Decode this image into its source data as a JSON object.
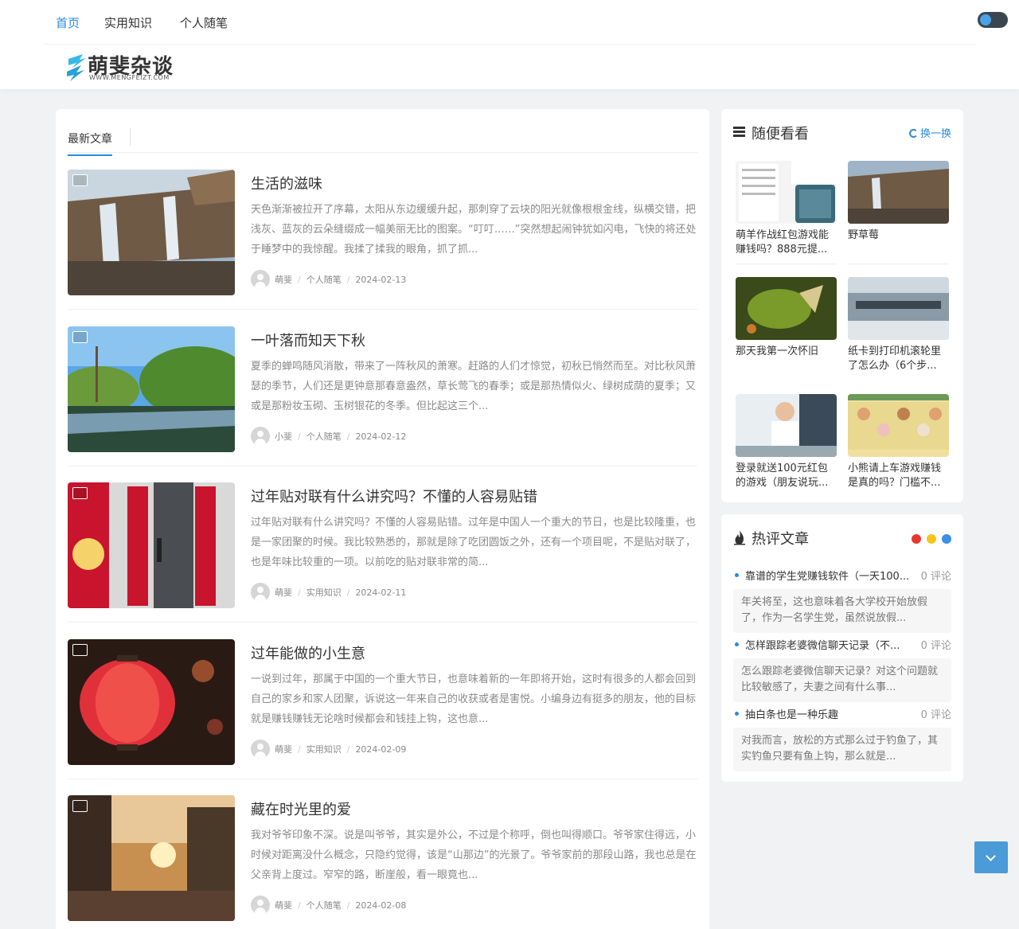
{
  "nav": {
    "items": [
      "首页",
      "实用知识",
      "个人随笔"
    ],
    "active_index": 0
  },
  "logo": {
    "title": "萌斐杂谈",
    "subtitle": "WWW.MENGFEIZT.COM"
  },
  "main": {
    "tab": "最新文章",
    "posts": [
      {
        "title": "生活的滋味",
        "excerpt": "天色渐渐被拉开了序幕，太阳从东边缓缓升起，那刺穿了云块的阳光就像根根金线，纵横交错，把浅灰、蓝灰的云朵缝缀成一幅美丽无比的图案。“叮叮……”突然想起闹钟犹如闪电，飞快的将还处于睡梦中的我惊醒。我揉了揉我的眼角，抓了抓...",
        "author": "萌斐",
        "category": "个人随笔",
        "date": "2024-02-13"
      },
      {
        "title": "一叶落而知天下秋",
        "excerpt": "夏季的蝉鸣随风消散，带来了一阵秋风的萧寒。赶路的人们才惊觉，初秋已悄然而至。对比秋风萧瑟的季节，人们还是更钟意那春意盎然，草长莺飞的春季；或是那热情似火、绿树成荫的夏季；又或是那粉妆玉砌、玉树银花的冬季。但比起这三个...",
        "author": "小斐",
        "category": "个人随笔",
        "date": "2024-02-12"
      },
      {
        "title": "过年贴对联有什么讲究吗？不懂的人容易贴错",
        "excerpt": "过年贴对联有什么讲究吗？不懂的人容易贴错。过年是中国人一个重大的节日，也是比较隆重，也是一家团聚的时候。我比较熟悉的，那就是除了吃团圆饭之外，还有一个项目呢，不是贴对联了，也是年味比较重的一项。以前吃的贴对联非常的简...",
        "author": "萌斐",
        "category": "实用知识",
        "date": "2024-02-11"
      },
      {
        "title": "过年能做的小生意",
        "excerpt": "一说到过年，那属于中国的一个重大节日，也意味着新的一年即将开始，这时有很多的人都会回到自己的家乡和家人团聚，诉说这一年来自己的收获或者是害悦。小编身边有挺多的朋友，他的目标就是赚钱赚钱无论啥时候都会和钱挂上钩，这也意...",
        "author": "萌斐",
        "category": "实用知识",
        "date": "2024-02-09"
      },
      {
        "title": "藏在时光里的爱",
        "excerpt": "我对爷爷印象不深。说是叫爷爷，其实是外公，不过是个称呼，倒也叫得顺口。爷爷家住得远，小时候对距离没什么概念，只隐约觉得，该是“山那边”的光景了。爷爷家前的那段山路，我也总是在父亲背上度过。窄窄的路，断崖般，看一眼竟也...",
        "author": "萌斐",
        "category": "个人随笔",
        "date": "2024-02-08"
      }
    ]
  },
  "random_widget": {
    "title": "随便看看",
    "refresh_label": "换一换",
    "items": [
      {
        "title": "萌羊作战红包游戏能赚钱吗？888元提..."
      },
      {
        "title": "野草莓"
      },
      {
        "title": "那天我第一次怀旧"
      },
      {
        "title": "纸卡到打印机滚轮里了怎么办（6个步..."
      },
      {
        "title": "登录就送100元红包的游戏（朋友说玩..."
      },
      {
        "title": "小熊请上车游戏赚钱是真的吗？门槛不..."
      }
    ]
  },
  "hot_widget": {
    "title": "热评文章",
    "dot_colors": [
      "#e8382e",
      "#f5c518",
      "#3a8ee6"
    ],
    "items": [
      {
        "title": "靠谱的学生党赚钱软件（一天100...",
        "comments": "0 评论",
        "summary": "年关将至，这也意味着各大学校开始放假了，作为一名学生党，虽然说放假..."
      },
      {
        "title": "怎样跟踪老婆微信聊天记录（不...",
        "comments": "0 评论",
        "summary": "怎么跟踪老婆微信聊天记录？对这个问题就比较敏感了，夫妻之间有什么事..."
      },
      {
        "title": "抽白条也是一种乐趣",
        "comments": "0 评论",
        "summary": "对我而言，放松的方式那么过于钓鱼了，其实钓鱼只要有鱼上钩，那么就是..."
      }
    ]
  },
  "colors": {
    "accent": "#2a8bd8",
    "background": "#f1f2f3"
  }
}
